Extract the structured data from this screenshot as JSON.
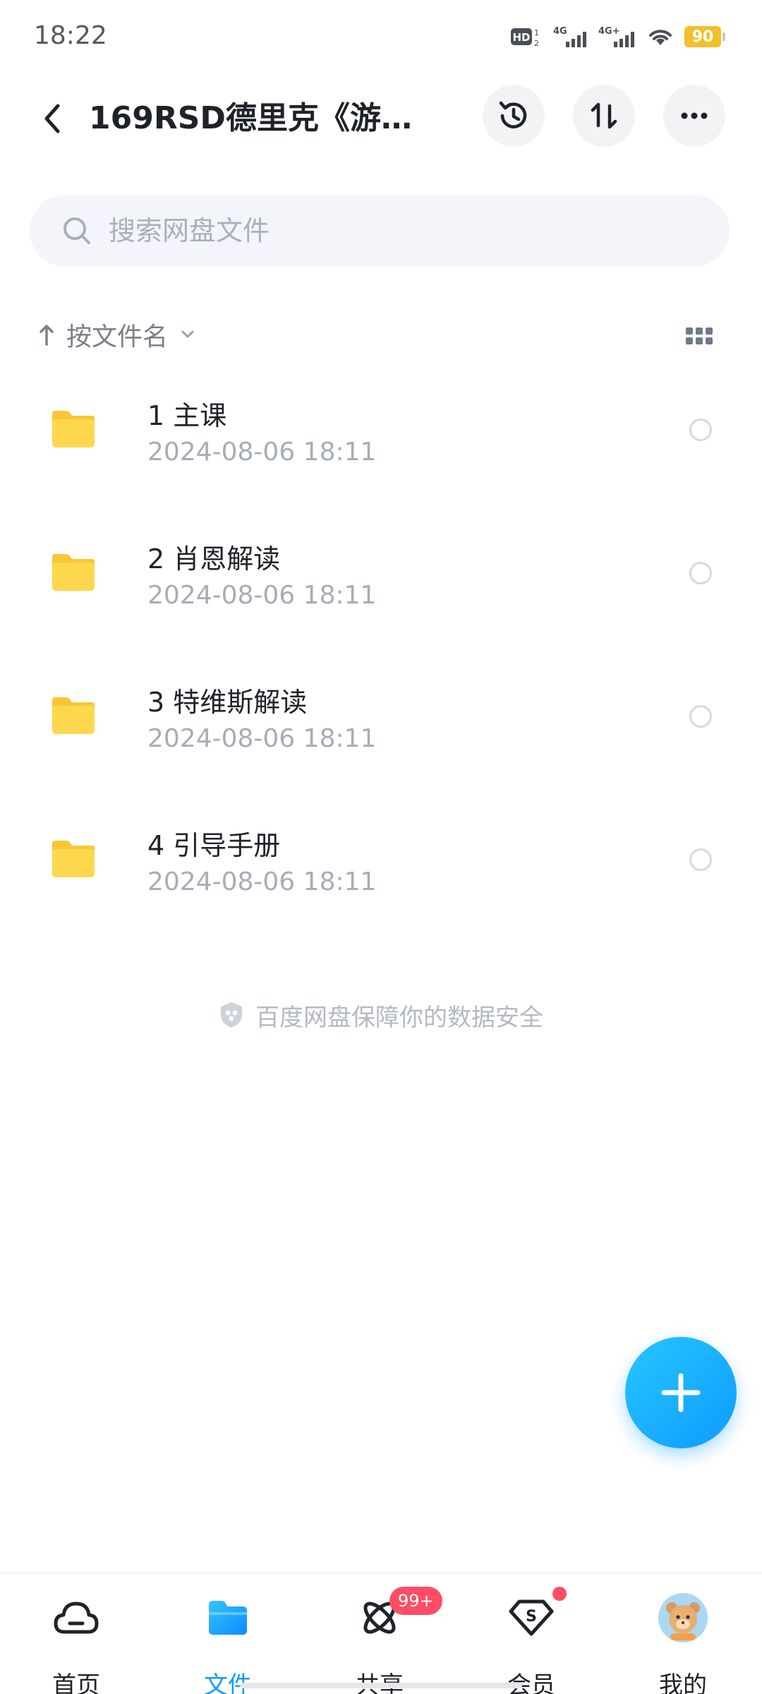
{
  "status_bar": {
    "time": "18:22",
    "hd_label": "HD",
    "sim1": "4G",
    "sim2": "4G+",
    "battery": "90"
  },
  "header": {
    "title": "169RSD德里克《游…",
    "back_icon": "chevron-left-icon",
    "history_icon": "history-icon",
    "transfer_icon": "transfer-icon",
    "more_icon": "more-icon"
  },
  "search": {
    "placeholder": "搜索网盘文件"
  },
  "sort": {
    "label": "按文件名"
  },
  "files": [
    {
      "name": "1 主课",
      "date": "2024-08-06  18:11"
    },
    {
      "name": "2 肖恩解读",
      "date": "2024-08-06  18:11"
    },
    {
      "name": "3 特维斯解读",
      "date": "2024-08-06  18:11"
    },
    {
      "name": "4 引导手册",
      "date": "2024-08-06  18:11"
    }
  ],
  "safety_text": "百度网盘保障你的数据安全",
  "nav": {
    "items": [
      {
        "label": "首页",
        "icon": "cloud-icon"
      },
      {
        "label": "文件",
        "icon": "folder-icon"
      },
      {
        "label": "共享",
        "icon": "share-orbit-icon",
        "badge": "99+"
      },
      {
        "label": "会员",
        "icon": "vip-diamond-icon"
      },
      {
        "label": "我的",
        "icon": "avatar-icon"
      }
    ],
    "active": "文件"
  },
  "colors": {
    "accent": "#0d9bff",
    "folder": "#fdd149",
    "badge": "#ff4d66",
    "battery": "#f1c02b"
  }
}
